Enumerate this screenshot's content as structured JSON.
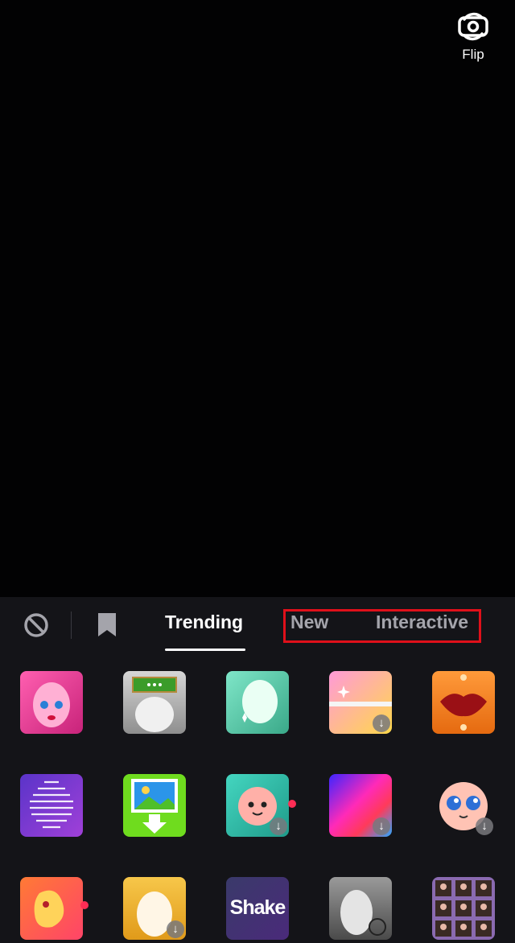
{
  "camera": {
    "flip_label": "Flip"
  },
  "tabs": {
    "trending": "Trending",
    "new": "New",
    "interactive": "Interactive"
  },
  "effects": [
    {
      "name": "pink-face-effect"
    },
    {
      "name": "toilet-effect"
    },
    {
      "name": "green-mask-effect"
    },
    {
      "name": "gold-sparkle-effect",
      "download": true
    },
    {
      "name": "lips-effect"
    },
    {
      "name": "fingerprint-effect"
    },
    {
      "name": "photo-download-effect"
    },
    {
      "name": "cute-face-scan-effect",
      "download": true,
      "new_dot": true
    },
    {
      "name": "color-gradient-effect",
      "download": true
    },
    {
      "name": "big-eyes-effect",
      "download": true
    },
    {
      "name": "orange-blob-effect",
      "new_dot": true
    },
    {
      "name": "gold-mask-effect",
      "download": true
    },
    {
      "name": "shake-effect",
      "label": "Shake"
    },
    {
      "name": "grey-mask-effect"
    },
    {
      "name": "photo-grid-effect"
    }
  ],
  "colors": {
    "highlight": "#e0101a",
    "dot": "#ff2d55"
  }
}
